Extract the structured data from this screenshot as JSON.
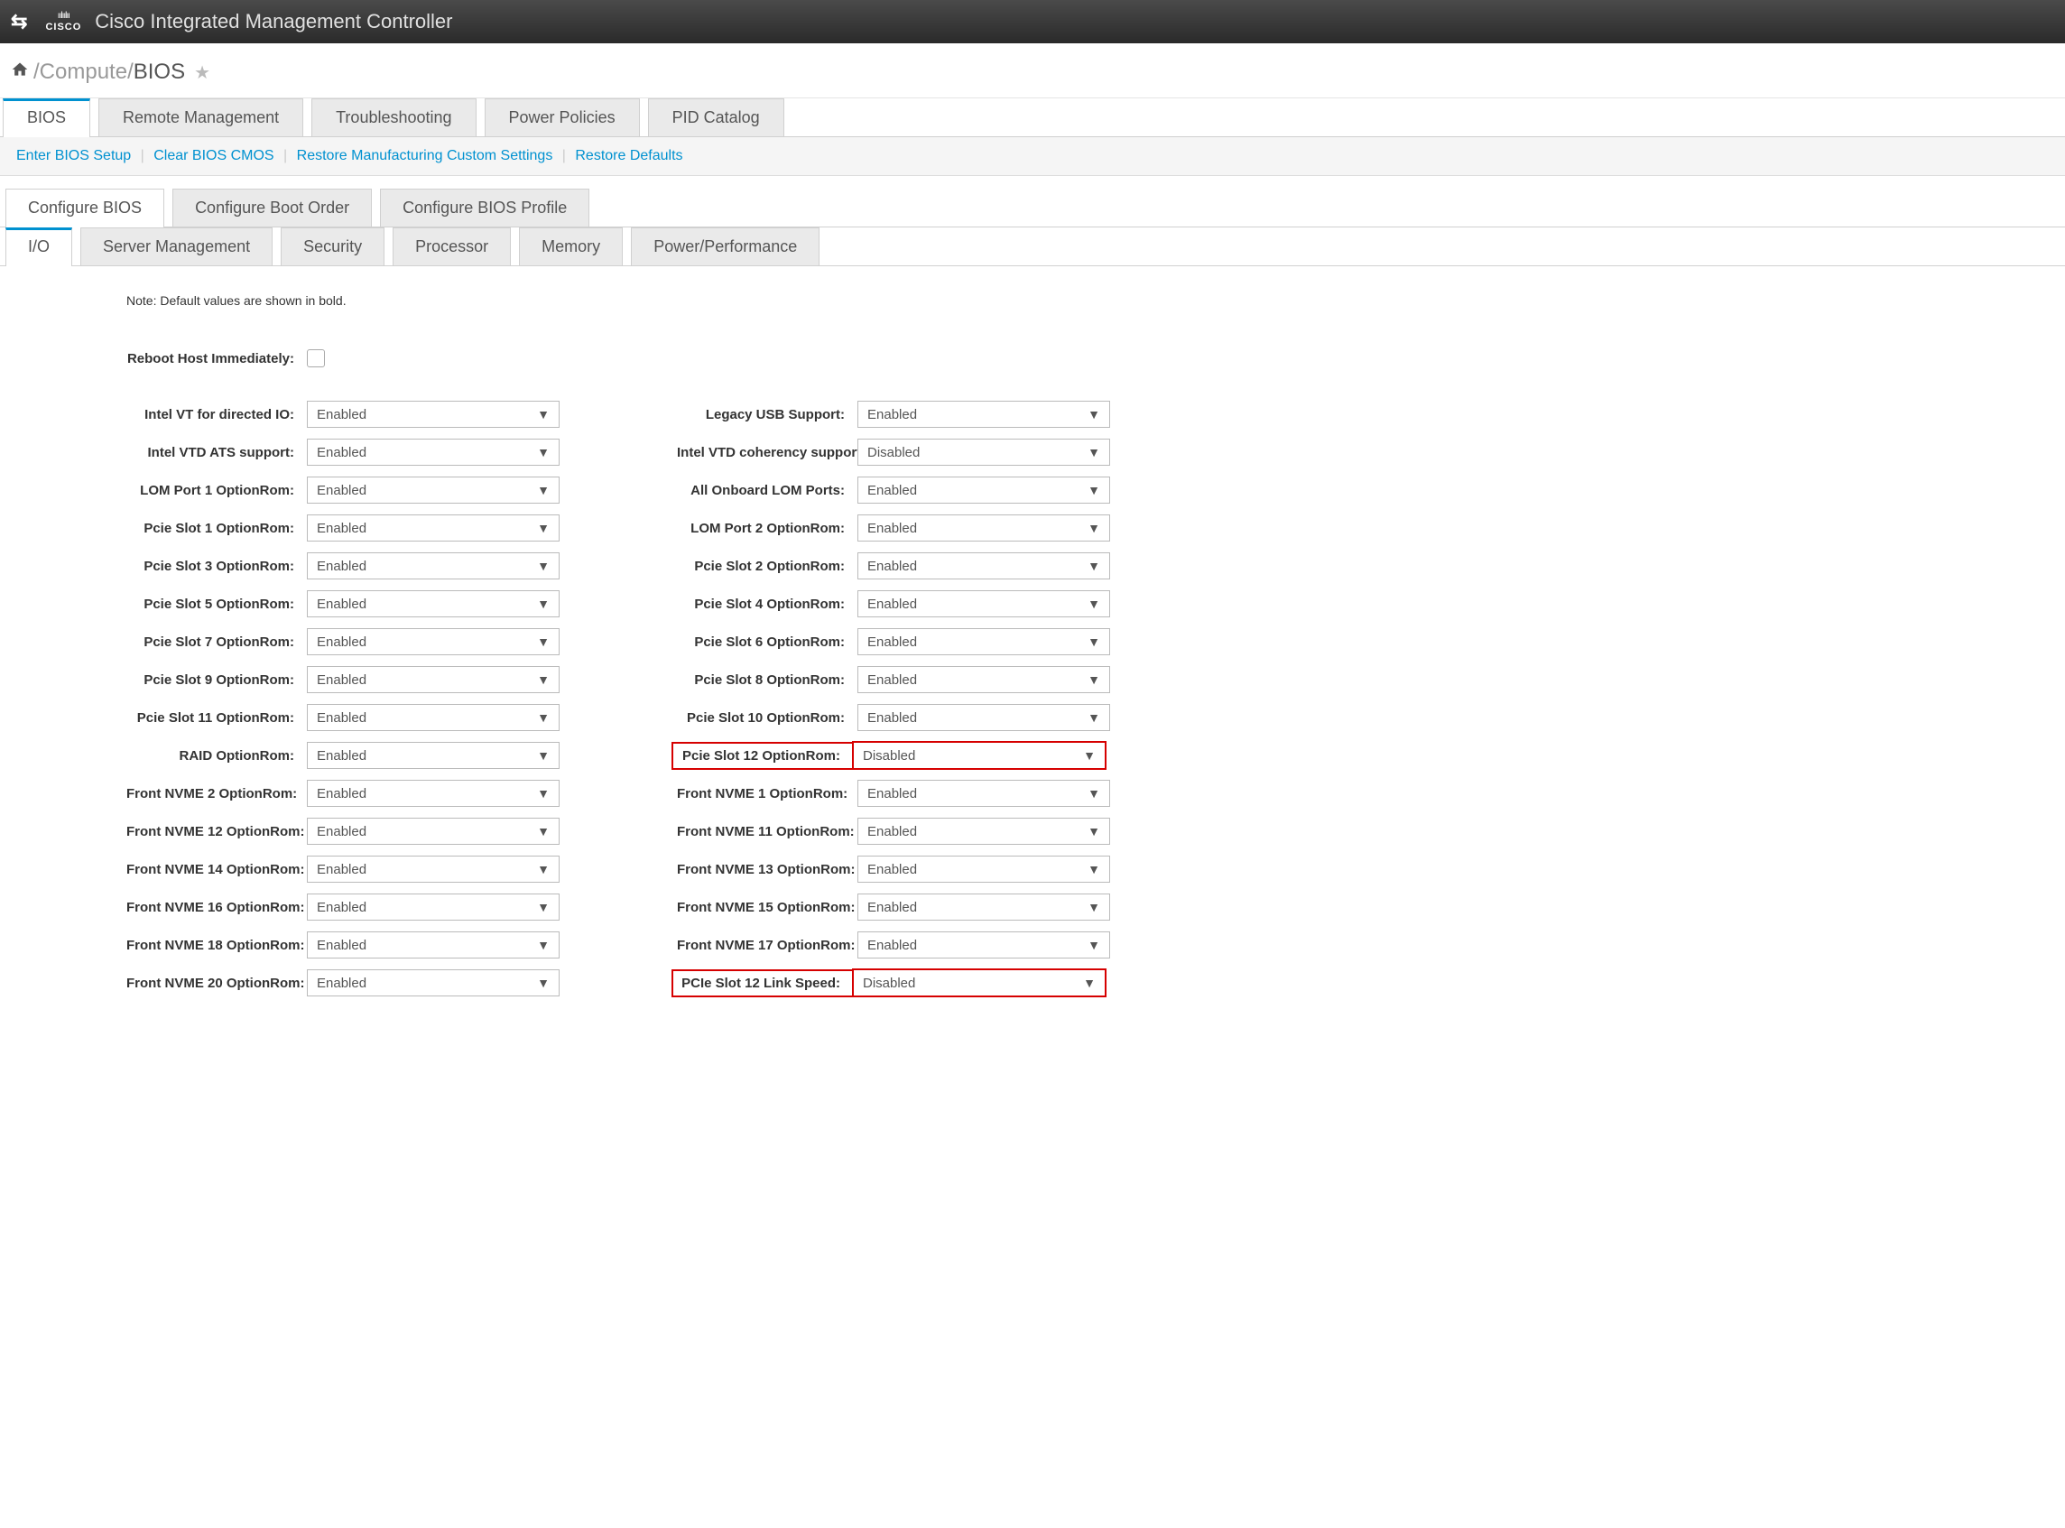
{
  "header": {
    "logo_top": "ıılıılıı",
    "logo_text": "CISCO",
    "title": "Cisco Integrated Management Controller"
  },
  "breadcrumb": {
    "sep": " / ",
    "item1": "Compute",
    "current": "BIOS"
  },
  "tabs1": [
    {
      "label": "BIOS",
      "active": true
    },
    {
      "label": "Remote Management",
      "active": false
    },
    {
      "label": "Troubleshooting",
      "active": false
    },
    {
      "label": "Power Policies",
      "active": false
    },
    {
      "label": "PID Catalog",
      "active": false
    }
  ],
  "action_links": [
    "Enter BIOS Setup",
    "Clear BIOS CMOS",
    "Restore Manufacturing Custom Settings",
    "Restore Defaults"
  ],
  "tabs2": [
    {
      "label": "Configure BIOS",
      "active": true
    },
    {
      "label": "Configure Boot Order",
      "active": false
    },
    {
      "label": "Configure BIOS Profile",
      "active": false
    }
  ],
  "tabs3": [
    {
      "label": "I/O",
      "active": true
    },
    {
      "label": "Server Management",
      "active": false
    },
    {
      "label": "Security",
      "active": false
    },
    {
      "label": "Processor",
      "active": false
    },
    {
      "label": "Memory",
      "active": false
    },
    {
      "label": "Power/Performance",
      "active": false
    }
  ],
  "note": "Note: Default values are shown in bold.",
  "reboot_label": "Reboot Host Immediately:",
  "left_settings": [
    {
      "label": "Intel VT for directed IO:",
      "value": "Enabled"
    },
    {
      "label": "Intel VTD ATS support:",
      "value": "Enabled"
    },
    {
      "label": "LOM Port 1 OptionRom:",
      "value": "Enabled"
    },
    {
      "label": "Pcie Slot 1 OptionRom:",
      "value": "Enabled"
    },
    {
      "label": "Pcie Slot 3 OptionRom:",
      "value": "Enabled"
    },
    {
      "label": "Pcie Slot 5 OptionRom:",
      "value": "Enabled"
    },
    {
      "label": "Pcie Slot 7 OptionRom:",
      "value": "Enabled"
    },
    {
      "label": "Pcie Slot 9 OptionRom:",
      "value": "Enabled"
    },
    {
      "label": "Pcie Slot 11 OptionRom:",
      "value": "Enabled"
    },
    {
      "label": "RAID OptionRom:",
      "value": "Enabled"
    },
    {
      "label": "Front NVME 2 OptionRom:",
      "value": "Enabled"
    },
    {
      "label": "Front NVME 12 OptionRom:",
      "value": "Enabled"
    },
    {
      "label": "Front NVME 14 OptionRom:",
      "value": "Enabled"
    },
    {
      "label": "Front NVME 16 OptionRom:",
      "value": "Enabled"
    },
    {
      "label": "Front NVME 18 OptionRom:",
      "value": "Enabled"
    },
    {
      "label": "Front NVME 20 OptionRom:",
      "value": "Enabled"
    }
  ],
  "right_settings": [
    {
      "label": "Legacy USB Support:",
      "value": "Enabled",
      "highlighted": false
    },
    {
      "label": "Intel VTD coherency support:",
      "value": "Disabled",
      "highlighted": false
    },
    {
      "label": "All Onboard LOM Ports:",
      "value": "Enabled",
      "highlighted": false
    },
    {
      "label": "LOM Port 2 OptionRom:",
      "value": "Enabled",
      "highlighted": false
    },
    {
      "label": "Pcie Slot 2 OptionRom:",
      "value": "Enabled",
      "highlighted": false
    },
    {
      "label": "Pcie Slot 4 OptionRom:",
      "value": "Enabled",
      "highlighted": false
    },
    {
      "label": "Pcie Slot 6 OptionRom:",
      "value": "Enabled",
      "highlighted": false
    },
    {
      "label": "Pcie Slot 8 OptionRom:",
      "value": "Enabled",
      "highlighted": false
    },
    {
      "label": "Pcie Slot 10 OptionRom:",
      "value": "Enabled",
      "highlighted": false
    },
    {
      "label": "Pcie Slot 12 OptionRom:",
      "value": "Disabled",
      "highlighted": true
    },
    {
      "label": "Front NVME 1 OptionRom:",
      "value": "Enabled",
      "highlighted": false
    },
    {
      "label": "Front NVME 11 OptionRom:",
      "value": "Enabled",
      "highlighted": false
    },
    {
      "label": "Front NVME 13 OptionRom:",
      "value": "Enabled",
      "highlighted": false
    },
    {
      "label": "Front NVME 15 OptionRom:",
      "value": "Enabled",
      "highlighted": false
    },
    {
      "label": "Front NVME 17 OptionRom:",
      "value": "Enabled",
      "highlighted": false
    },
    {
      "label": "PCIe Slot 12 Link Speed:",
      "value": "Disabled",
      "highlighted": true
    }
  ]
}
